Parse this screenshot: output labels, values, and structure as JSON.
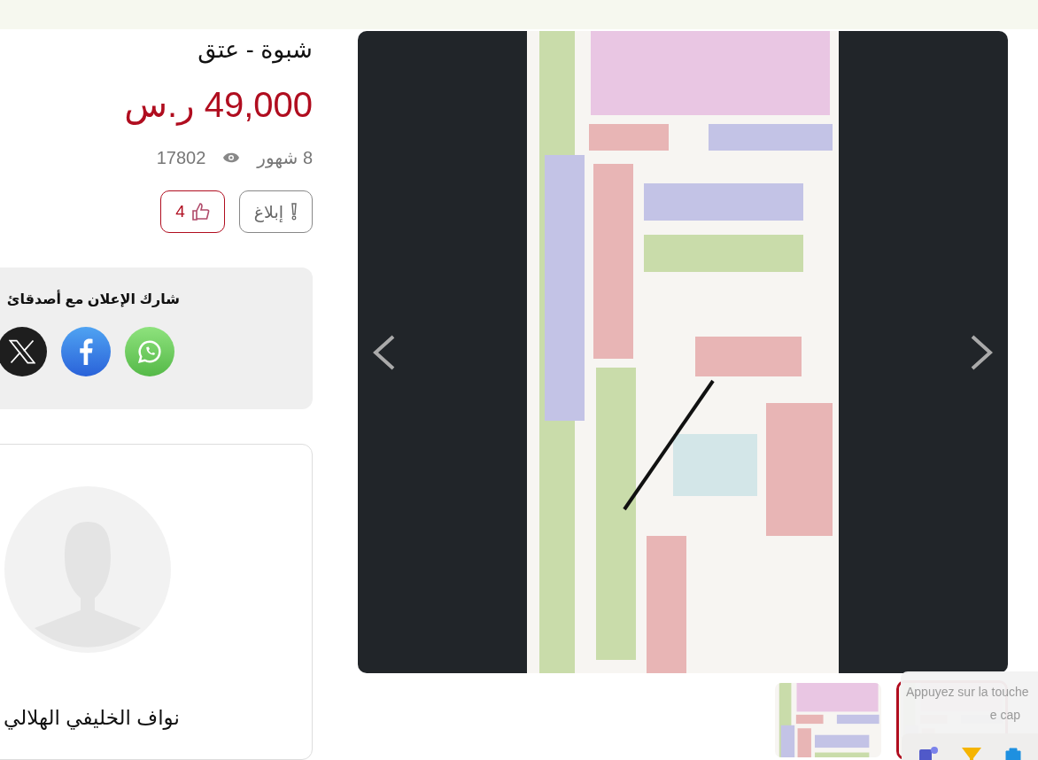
{
  "listing": {
    "title": "شبوة - عتق",
    "price": "49,000 ر.س",
    "age": "8 شهور",
    "views": "17802",
    "report_label": "إبلاغ",
    "likes": "4"
  },
  "share": {
    "title": "شارك الإعلان مع أصدقائ",
    "networks": [
      {
        "kind": "whatsapp"
      },
      {
        "kind": "facebook"
      },
      {
        "kind": "x"
      }
    ]
  },
  "seller": {
    "name": "نواف الخليفي الهلالي"
  },
  "gallery": {
    "thumbnails": [
      {
        "selected": false
      },
      {
        "selected": true
      }
    ]
  },
  "notification": {
    "lines": [
      "Appuyez sur la touche",
      "e cap"
    ]
  },
  "tray": {
    "apps": [
      {
        "kind": "teams"
      },
      {
        "kind": "funnel"
      },
      {
        "kind": "store"
      }
    ]
  }
}
